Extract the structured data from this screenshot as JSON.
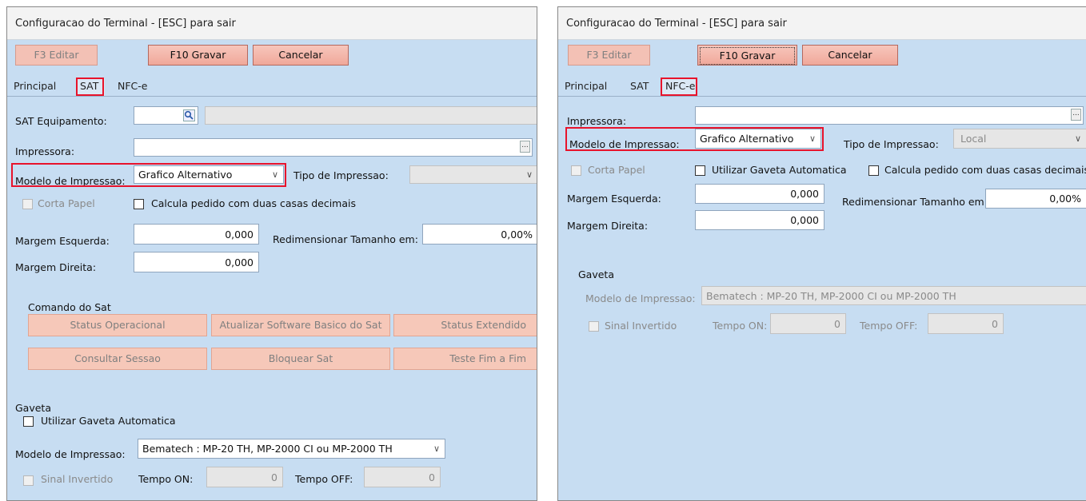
{
  "left": {
    "title": "Configuracao do Terminal - [ESC] para sair",
    "toolbar": {
      "edit": "F3 Editar",
      "save": "F10 Gravar",
      "cancel": "Cancelar"
    },
    "tabs": [
      "Principal",
      "SAT",
      "NFC-e"
    ],
    "sat_equipamento_label": "SAT Equipamento:",
    "impressora_label": "Impressora:",
    "impressora_value": "",
    "modelo_label": "Modelo de Impressao:",
    "modelo_value": "Grafico Alternativo",
    "tipo_label": "Tipo de Impressao:",
    "tipo_value": "",
    "corta_papel": "Corta Papel",
    "calcula_pedido": "Calcula pedido com duas casas decimais",
    "margem_esq_label": "Margem Esquerda:",
    "margem_esq_value": "0,000",
    "redim_label": "Redimensionar Tamanho em:",
    "redim_value": "0,00%",
    "margem_dir_label": "Margem Direita:",
    "margem_dir_value": "0,000",
    "comando_title": "Comando do Sat",
    "comando_buttons": [
      "Status Operacional",
      "Atualizar Software Basico do Sat",
      "Status Extendido",
      "Consultar Sessao",
      "Bloquear Sat",
      "Teste Fim a Fim"
    ],
    "gaveta_title": "Gaveta",
    "utilizar_gaveta": "Utilizar Gaveta Automatica",
    "gaveta_modelo_label": "Modelo de Impressao:",
    "gaveta_modelo_value": "Bematech : MP-20 TH, MP-2000 CI ou MP-2000 TH",
    "sinal_invertido": "Sinal Invertido",
    "tempo_on_label": "Tempo ON:",
    "tempo_on_value": "0",
    "tempo_off_label": "Tempo OFF:",
    "tempo_off_value": "0"
  },
  "right": {
    "title": "Configuracao do Terminal - [ESC] para sair",
    "toolbar": {
      "edit": "F3 Editar",
      "save": "F10 Gravar",
      "cancel": "Cancelar"
    },
    "tabs": [
      "Principal",
      "SAT",
      "NFC-e"
    ],
    "impressora_label": "Impressora:",
    "impressora_value": "",
    "modelo_label": "Modelo de Impressao:",
    "modelo_value": "Grafico Alternativo",
    "tipo_label": "Tipo de Impressao:",
    "tipo_value": "Local",
    "corta_papel": "Corta Papel",
    "utilizar_gaveta": "Utilizar Gaveta Automatica",
    "calcula_pedido": "Calcula pedido com duas casas decimais",
    "margem_esq_label": "Margem Esquerda:",
    "margem_esq_value": "0,000",
    "redim_label": "Redimensionar Tamanho em:",
    "redim_value": "0,00%",
    "margem_dir_label": "Margem Direita:",
    "margem_dir_value": "0,000",
    "gaveta_title": "Gaveta",
    "gaveta_modelo_label": "Modelo de Impressao:",
    "gaveta_modelo_value": "Bematech : MP-20 TH, MP-2000 CI ou MP-2000 TH",
    "sinal_invertido": "Sinal Invertido",
    "tempo_on_label": "Tempo ON:",
    "tempo_on_value": "0",
    "tempo_off_label": "Tempo OFF:",
    "tempo_off_value": "0"
  },
  "colors": {
    "panel": "#c7ddf2",
    "button": "#f0a89a",
    "highlight": "#e8132b"
  }
}
